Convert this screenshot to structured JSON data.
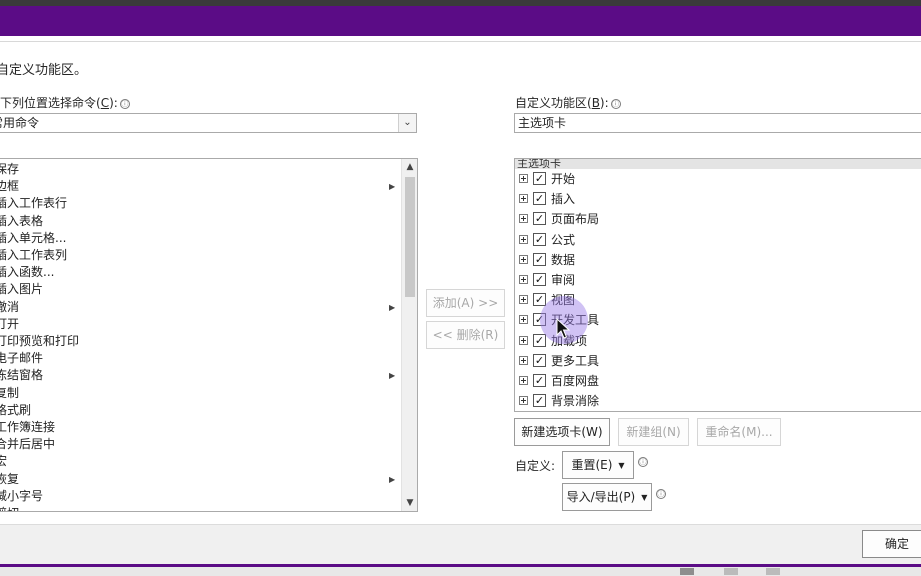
{
  "dialog": {
    "heading": "自定义功能区。",
    "left_label": "从下列位置选择命令(",
    "left_label_key": "C",
    "left_label_tail": "):",
    "left_combo_value": "常用命令",
    "right_label": "自定义功能区(",
    "right_label_key": "B",
    "right_label_tail": "):",
    "right_combo_value": "主选项卡",
    "info_icon": "ⓘ"
  },
  "commands": [
    {
      "label": "保存",
      "submenu": false
    },
    {
      "label": "边框",
      "submenu": true
    },
    {
      "label": "插入工作表行",
      "submenu": false
    },
    {
      "label": "插入表格",
      "submenu": false
    },
    {
      "label": "插入单元格...",
      "submenu": false
    },
    {
      "label": "插入工作表列",
      "submenu": false
    },
    {
      "label": "插入函数...",
      "submenu": false
    },
    {
      "label": "插入图片",
      "submenu": false
    },
    {
      "label": "撤消",
      "submenu": true
    },
    {
      "label": "打开",
      "submenu": false
    },
    {
      "label": "打印预览和打印",
      "submenu": false
    },
    {
      "label": "电子邮件",
      "submenu": false
    },
    {
      "label": "冻结窗格",
      "submenu": true
    },
    {
      "label": "复制",
      "submenu": false
    },
    {
      "label": "格式刷",
      "submenu": false
    },
    {
      "label": "工作簿连接",
      "submenu": false
    },
    {
      "label": "合并后居中",
      "submenu": false
    },
    {
      "label": "宏",
      "submenu": false
    },
    {
      "label": "恢复",
      "submenu": true
    },
    {
      "label": "减小字号",
      "submenu": false
    },
    {
      "label": "剪切",
      "submenu": false
    }
  ],
  "buttons": {
    "add": "添加(A) >>",
    "remove": "<< 删除(R)",
    "new_tab": "新建选项卡(W)",
    "new_group": "新建组(N)",
    "rename": "重命名(M)...",
    "customize_label": "自定义:",
    "reset": "重置(E)",
    "import_export": "导入/导出(P)",
    "ok": "确定"
  },
  "tree": {
    "header": "主选项卡",
    "items": [
      {
        "label": "开始",
        "checked": true
      },
      {
        "label": "插入",
        "checked": true
      },
      {
        "label": "页面布局",
        "checked": true
      },
      {
        "label": "公式",
        "checked": true
      },
      {
        "label": "数据",
        "checked": true
      },
      {
        "label": "审阅",
        "checked": true
      },
      {
        "label": "视图",
        "checked": true
      },
      {
        "label": "开发工具",
        "checked": true
      },
      {
        "label": "加载项",
        "checked": true
      },
      {
        "label": "更多工具",
        "checked": true
      },
      {
        "label": "百度网盘",
        "checked": true
      },
      {
        "label": "背景消除",
        "checked": true
      }
    ]
  },
  "icons": {
    "dropdown": "chevron-down-icon",
    "check": "✓",
    "submenu": "▶",
    "scroll_up": "▲",
    "scroll_down": "▼",
    "caret": "▼"
  }
}
